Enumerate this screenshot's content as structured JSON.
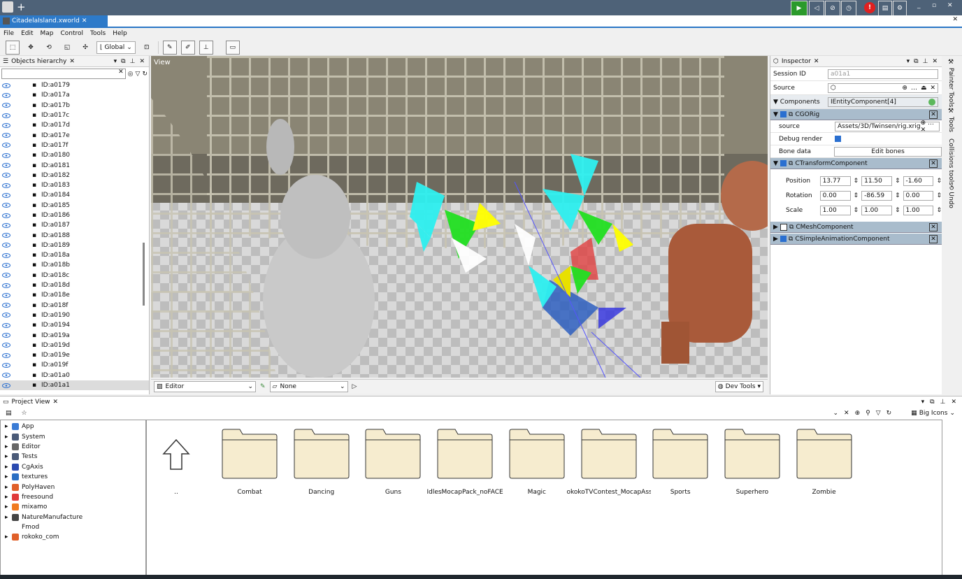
{
  "app": {
    "document_tab": "CitadelaIsland.xworld",
    "menu": [
      "File",
      "Edit",
      "Map",
      "Control",
      "Tools",
      "Help"
    ],
    "toolbar": {
      "coordinate_space": "Global"
    }
  },
  "hierarchy": {
    "title": "Objects hierarchy",
    "items": [
      "ID:a0179",
      "ID:a017a",
      "ID:a017b",
      "ID:a017c",
      "ID:a017d",
      "ID:a017e",
      "ID:a017f",
      "ID:a0180",
      "ID:a0181",
      "ID:a0182",
      "ID:a0183",
      "ID:a0184",
      "ID:a0185",
      "ID:a0186",
      "ID:a0187",
      "ID:a0188",
      "ID:a0189",
      "ID:a018a",
      "ID:a018b",
      "ID:a018c",
      "ID:a018d",
      "ID:a018e",
      "ID:a018f",
      "ID:a0190",
      "ID:a0194",
      "ID:a019a",
      "ID:a019d",
      "ID:a019e",
      "ID:a019f",
      "ID:a01a0",
      "ID:a01a1"
    ],
    "selected": "ID:a01a1"
  },
  "viewport": {
    "label": "View",
    "mode": "Editor",
    "camera": "None",
    "dev_tools": "Dev Tools"
  },
  "inspector": {
    "title": "Inspector",
    "session_id_label": "Session ID",
    "session_id": "a01a1",
    "source_label": "Source",
    "components_label": "Components",
    "components_type": "IEntityComponent[4]",
    "rig": {
      "name": "CGORig",
      "source_label": "source",
      "source_value": "Assets/3D/Twinsen/rig.xrig",
      "debug_label": "Debug render",
      "bone_label": "Bone data",
      "bone_button": "Edit bones"
    },
    "transform": {
      "name": "CTransformComponent",
      "position_label": "Position",
      "position": [
        "13.77",
        "11.50",
        "-1.60"
      ],
      "rotation_label": "Rotation",
      "rotation": [
        "0.00",
        "-86.59",
        "0.00"
      ],
      "scale_label": "Scale",
      "scale": [
        "1.00",
        "1.00",
        "1.00"
      ]
    },
    "mesh": "CMeshComponent",
    "anim": "CSimpleAnimationComponent"
  },
  "side_tabs": [
    "Painter Tools",
    "Tools",
    "Collisions tools",
    "Undo"
  ],
  "project": {
    "title": "Project View",
    "view_mode": "Big Icons",
    "tree": [
      {
        "label": "App",
        "icon": "app-icon",
        "color": "#3a7bd5"
      },
      {
        "label": "System",
        "icon": "disk-icon",
        "color": "#4a5a78"
      },
      {
        "label": "Editor",
        "icon": "editor-icon",
        "color": "#666666"
      },
      {
        "label": "Tests",
        "icon": "disk-icon",
        "color": "#4a5a78"
      },
      {
        "label": "CgAxis",
        "icon": "cgaxis-icon",
        "color": "#2a4ab0"
      },
      {
        "label": "textures",
        "icon": "textures-icon",
        "color": "#2b6fc4"
      },
      {
        "label": "PolyHaven",
        "icon": "polyhaven-icon",
        "color": "#e0602a"
      },
      {
        "label": "freesound",
        "icon": "freesound-icon",
        "color": "#e03a3a"
      },
      {
        "label": "mixamo",
        "icon": "mixamo-icon",
        "color": "#f07a20"
      },
      {
        "label": "NatureManufacture",
        "icon": "nature-icon",
        "color": "#444444"
      },
      {
        "label": "Fmod",
        "icon": "",
        "color": ""
      },
      {
        "label": "rokoko_com",
        "icon": "rokoko-icon",
        "color": "#e0602a"
      }
    ],
    "up_label": "..",
    "folders": [
      "Combat",
      "Dancing",
      "Guns",
      "IdlesMocapPack_noFACE",
      "Magic",
      "okokoTVContest_MocapAsse",
      "Sports",
      "Superhero",
      "Zombie"
    ]
  }
}
